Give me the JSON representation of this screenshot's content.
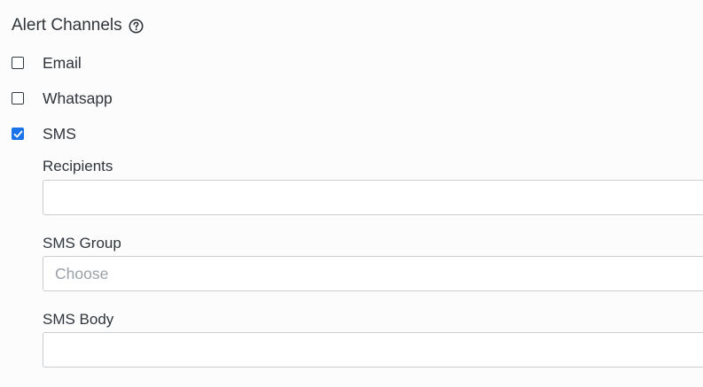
{
  "section": {
    "title": "Alert Channels",
    "help_icon": "question-circle-icon"
  },
  "channels": [
    {
      "label": "Email",
      "checked": false
    },
    {
      "label": "Whatsapp",
      "checked": false
    },
    {
      "label": "SMS",
      "checked": true
    }
  ],
  "sms": {
    "recipients": {
      "label": "Recipients",
      "value": ""
    },
    "group": {
      "label": "SMS Group",
      "placeholder": "Choose",
      "value": ""
    },
    "body": {
      "label": "SMS Body",
      "value": ""
    }
  },
  "colors": {
    "accent": "#1a73e8",
    "border": "#c9cdd1",
    "text": "#2f353b",
    "placeholder": "#9aa1a7"
  }
}
